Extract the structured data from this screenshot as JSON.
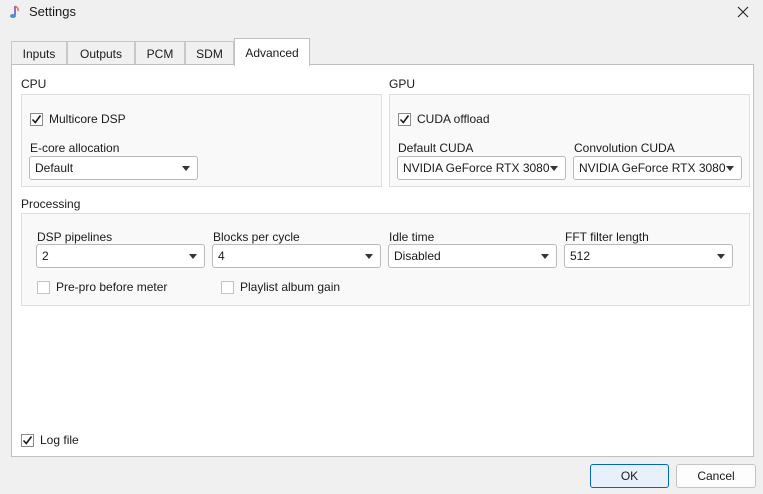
{
  "window": {
    "title": "Settings",
    "icon": "app-icon",
    "close_icon": "close-icon"
  },
  "tabs": [
    {
      "label": "Inputs",
      "active": false
    },
    {
      "label": "Outputs",
      "active": false
    },
    {
      "label": "PCM",
      "active": false
    },
    {
      "label": "SDM",
      "active": false
    },
    {
      "label": "Advanced",
      "active": true
    }
  ],
  "cpu": {
    "title": "CPU",
    "multicore": {
      "label": "Multicore DSP",
      "checked": true
    },
    "ecore": {
      "label": "E-core allocation",
      "value": "Default"
    }
  },
  "gpu": {
    "title": "GPU",
    "cuda_offload": {
      "label": "CUDA offload",
      "checked": true
    },
    "default_cuda": {
      "label": "Default CUDA",
      "value": "NVIDIA GeForce RTX 3080"
    },
    "convolution_cuda": {
      "label": "Convolution CUDA",
      "value": "NVIDIA GeForce RTX 3080"
    }
  },
  "processing": {
    "title": "Processing",
    "dsp_pipelines": {
      "label": "DSP pipelines",
      "value": "2"
    },
    "blocks_per_cycle": {
      "label": "Blocks per cycle",
      "value": "4"
    },
    "idle_time": {
      "label": "Idle time",
      "value": "Disabled"
    },
    "fft_filter_length": {
      "label": "FFT filter length",
      "value": "512"
    },
    "prepro": {
      "label": "Pre-pro before meter",
      "checked": false
    },
    "album_gain": {
      "label": "Playlist album gain",
      "checked": false
    }
  },
  "log_file": {
    "label": "Log file",
    "checked": true
  },
  "buttons": {
    "ok": "OK",
    "cancel": "Cancel"
  },
  "colors": {
    "accent": "#0067c0",
    "panel": "#ffffff",
    "group": "#f9f9f9",
    "window": "#f0f0f0"
  }
}
